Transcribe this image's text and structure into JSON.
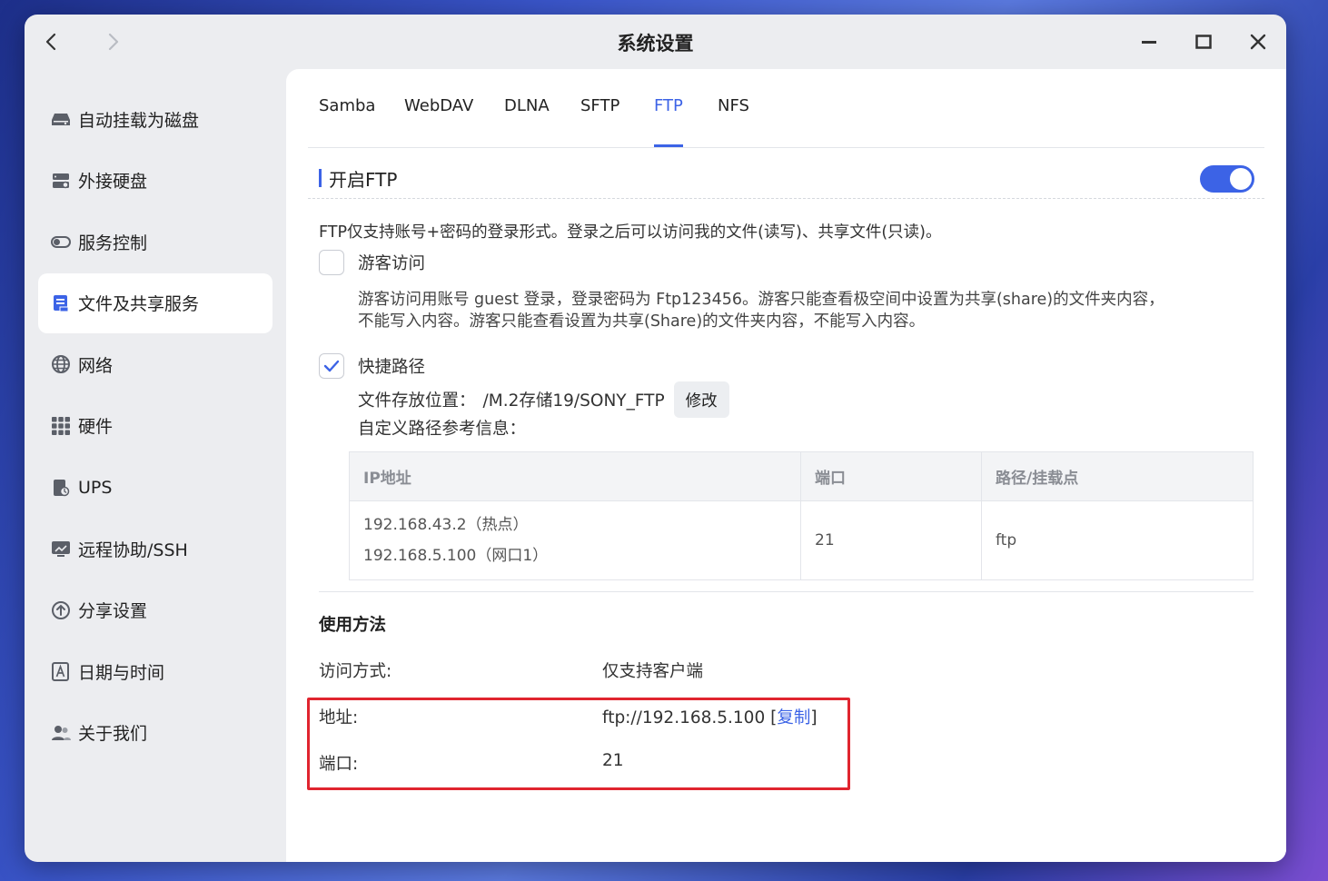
{
  "window": {
    "title": "系统设置"
  },
  "sidebar": {
    "items": [
      {
        "label": "自动挂载为磁盘",
        "icon": "drive-icon"
      },
      {
        "label": "外接硬盘",
        "icon": "external-disk-icon"
      },
      {
        "label": "服务控制",
        "icon": "toggle-icon"
      },
      {
        "label": "文件及共享服务",
        "icon": "file-share-icon",
        "active": true
      },
      {
        "label": "网络",
        "icon": "globe-icon"
      },
      {
        "label": "硬件",
        "icon": "grid-icon"
      },
      {
        "label": "UPS",
        "icon": "ups-icon"
      },
      {
        "label": "远程协助/SSH",
        "icon": "remote-icon"
      },
      {
        "label": "分享设置",
        "icon": "share-icon"
      },
      {
        "label": "日期与时间",
        "icon": "calendar-icon"
      },
      {
        "label": "关于我们",
        "icon": "users-icon"
      }
    ]
  },
  "tabs": [
    "Samba",
    "WebDAV",
    "DLNA",
    "SFTP",
    "FTP",
    "NFS"
  ],
  "active_tab": "FTP",
  "ftp": {
    "section_title": "开启FTP",
    "enabled": true,
    "description": "FTP仅支持账号+密码的登录形式。登录之后可以访问我的文件(读写)、共享文件(只读)。",
    "guest": {
      "label": "游客访问",
      "checked": false,
      "desc_line1": "游客访问用账号 guest 登录，登录密码为 Ftp123456。游客只能查看极空间中设置为共享(share)的文件夹内容，",
      "desc_line2": "不能写入内容。游客只能查看设置为共享(Share)的文件夹内容，不能写入内容。"
    },
    "shortcut": {
      "label": "快捷路径",
      "checked": true,
      "location_label": "文件存放位置：",
      "location_value": "/M.2存储19/SONY_FTP",
      "edit_button": "修改",
      "ref_label": "自定义路径参考信息："
    },
    "table": {
      "headers": [
        "IP地址",
        "端口",
        "路径/挂载点"
      ],
      "ip_lines": [
        "192.168.43.2（热点）",
        "192.168.5.100（网口1）"
      ],
      "port": "21",
      "path": "ftp"
    },
    "usage": {
      "title": "使用方法",
      "access_label": "访问方式:",
      "access_value": "仅支持客户端",
      "address_label": "地址:",
      "address_value": "ftp://192.168.5.100",
      "copy_label": "复制",
      "port_label": "端口:",
      "port_value": "21"
    }
  },
  "colors": {
    "accent": "#3c63e6",
    "highlight": "#e0252f"
  }
}
